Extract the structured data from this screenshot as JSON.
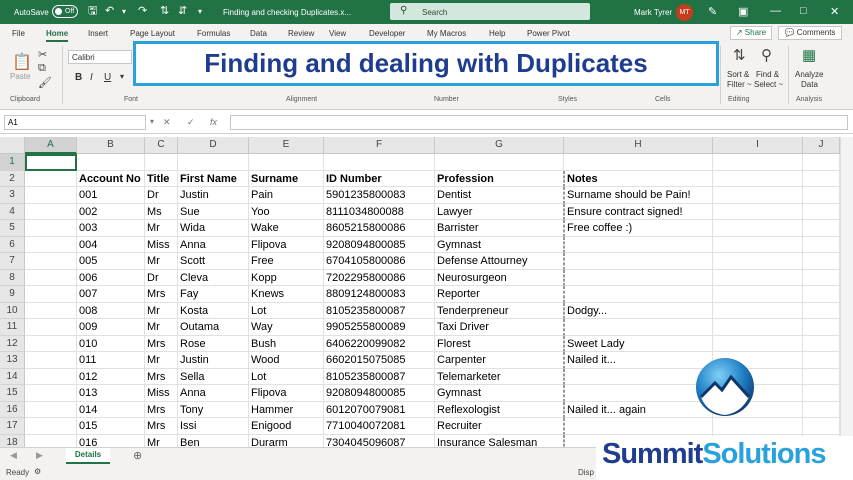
{
  "titlebar": {
    "autosave_label": "AutoSave",
    "autosave_state": "Off",
    "filename": "Finding and checking Duplicates.x...",
    "search_placeholder": "Search",
    "user_name": "Mark Tyrer",
    "user_initials": "MT"
  },
  "tabs": [
    "File",
    "Home",
    "Insert",
    "Page Layout",
    "Formulas",
    "Data",
    "Review",
    "View",
    "Developer",
    "My Macros",
    "Help",
    "Power Pivot"
  ],
  "active_tab": "Home",
  "share_label": "Share",
  "comments_label": "Comments",
  "ribbon": {
    "paste_label": "Paste",
    "font_name": "Calibri",
    "groups": [
      "Clipboard",
      "Font",
      "Alignment",
      "Number",
      "Styles",
      "Cells",
      "Editing",
      "Analysis"
    ],
    "sort_label": "Sort &",
    "sort_label2": "Filter ~",
    "find_label": "Find &",
    "find_label2": "Select ~",
    "analyze_label": "Analyze",
    "analyze_label2": "Data"
  },
  "banner_title": "Finding and dealing with Duplicates",
  "namebox": "A1",
  "columns": [
    "A",
    "B",
    "C",
    "D",
    "E",
    "F",
    "G",
    "H",
    "I",
    "J"
  ],
  "headers": [
    "Account No",
    "Title",
    "First Name",
    "Surname",
    "ID Number",
    "Profession",
    "Notes"
  ],
  "rows": [
    [
      "001",
      "Dr",
      "Justin",
      "Pain",
      "5901235800083",
      "Dentist",
      "Surname should be Pain!"
    ],
    [
      "002",
      "Ms",
      "Sue",
      "Yoo",
      "8111034800088",
      "Lawyer",
      "Ensure contract signed!"
    ],
    [
      "003",
      "Mr",
      "Wida",
      "Wake",
      "8605215800086",
      "Barrister",
      "Free coffee :)"
    ],
    [
      "004",
      "Miss",
      "Anna",
      "Flipova",
      "9208094800085",
      "Gymnast",
      ""
    ],
    [
      "005",
      "Mr",
      "Scott",
      "Free",
      "6704105800086",
      "Defense Attourney",
      ""
    ],
    [
      "006",
      "Dr",
      "Cleva",
      "Kopp",
      "7202295800086",
      "Neurosurgeon",
      ""
    ],
    [
      "007",
      "Mrs",
      "Fay",
      "Knews",
      "8809124800083",
      "Reporter",
      ""
    ],
    [
      "008",
      "Mr",
      "Kosta",
      "Lot",
      "8105235800087",
      "Tenderpreneur",
      "Dodgy..."
    ],
    [
      "009",
      "Mr",
      "Outama",
      "Way",
      "9905255800089",
      "Taxi Driver",
      ""
    ],
    [
      "010",
      "Mrs",
      "Rose",
      "Bush",
      "6406220099082",
      "Florest",
      "Sweet Lady"
    ],
    [
      "011",
      "Mr",
      "Justin",
      "Wood",
      "6602015075085",
      "Carpenter",
      "Nailed it..."
    ],
    [
      "012",
      "Mrs",
      "Sella",
      "Lot",
      "8105235800087",
      "Telemarketer",
      ""
    ],
    [
      "013",
      "Miss",
      "Anna",
      "Flipova",
      "9208094800085",
      "Gymnast",
      ""
    ],
    [
      "014",
      "Mrs",
      "Tony",
      "Hammer",
      "6012070079081",
      "Reflexologist",
      "Nailed it... again"
    ],
    [
      "015",
      "Mrs",
      "Issi",
      "Enigood",
      "7710040072081",
      "Recruiter",
      ""
    ],
    [
      "016",
      "Mr",
      "Ben",
      "Durarm",
      "7304045096087",
      "Insurance Salesman",
      ""
    ]
  ],
  "sheet_tab": "Details",
  "status": "Ready",
  "status_right": "Disp",
  "logo_part1": "Summit",
  "logo_part2": "Solutions",
  "colors": {
    "excel_green": "#217346",
    "banner_border": "#29a1dc",
    "banner_text": "#1f3d8e",
    "logo_dark": "#1f3d8e",
    "logo_light": "#29a1dc"
  }
}
